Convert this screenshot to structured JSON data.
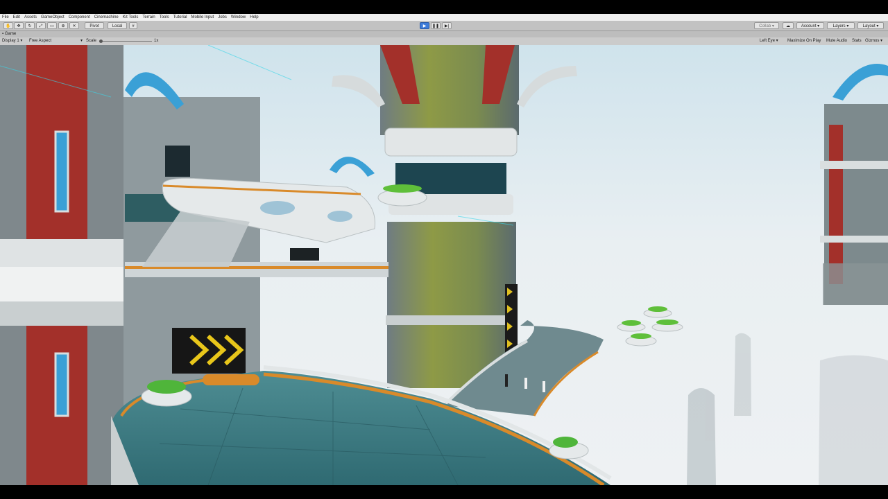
{
  "menu": [
    "File",
    "Edit",
    "Assets",
    "GameObject",
    "Component",
    "Cinemachine",
    "Kit Tools",
    "Terrain",
    "Tools",
    "Tutorial",
    "Mobile Input",
    "Jobs",
    "Window",
    "Help"
  ],
  "toolbar": {
    "pivot_label": "Pivot",
    "local_label": "Local",
    "collab_label": "Collab",
    "account_label": "Account",
    "layers_label": "Layers",
    "layout_label": "Layout"
  },
  "tab": {
    "label": "Game"
  },
  "gamebar": {
    "display": "Display 1",
    "aspect": "Free Aspect",
    "scale_label": "Scale",
    "scale_value": "1x",
    "eye": "Left Eye",
    "maximize": "Maximize On Play",
    "mute": "Mute Audio",
    "stats": "Stats",
    "gizmos": "Gizmos"
  },
  "colors": {
    "accent_play": "#3d7bd9",
    "sky": "#e8eef1",
    "tower_green": "#8c9a45",
    "deck": "#3f7f86"
  }
}
